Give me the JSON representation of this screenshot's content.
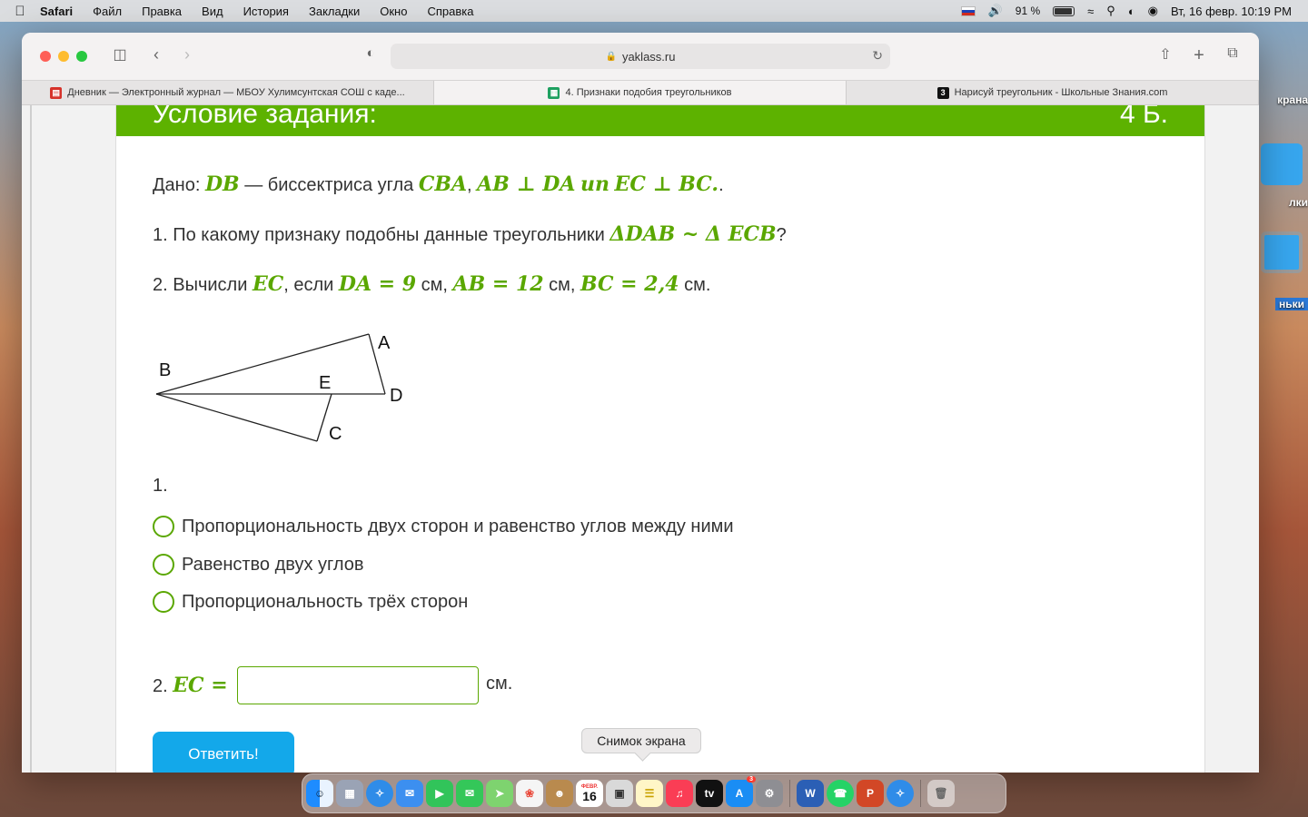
{
  "menubar": {
    "app": "Safari",
    "items": [
      "Файл",
      "Правка",
      "Вид",
      "История",
      "Закладки",
      "Окно",
      "Справка"
    ],
    "battery": "91 %",
    "datetime": "Вт, 16 февр.  10:19 PM"
  },
  "desktop": {
    "labels": [
      "крана",
      "лки",
      "ньки"
    ]
  },
  "browser": {
    "url": "yaklass.ru",
    "tabs": [
      {
        "title": "Дневник — Электронный журнал — МБОУ Хулимсунтская СОШ с каде...",
        "favicon_color": "#d6322a",
        "active": false
      },
      {
        "title": "4. Признаки подобия треугольников",
        "favicon_color": "#1ea060",
        "active": true
      },
      {
        "title": "Нарисуй треугольник - Школьные Знания.com",
        "favicon_color": "#111111",
        "favicon_text": "3",
        "active": false
      }
    ]
  },
  "task": {
    "header_title": "Условие задания:",
    "header_points": "4 Б.",
    "given_prefix": "Дано:",
    "given_db": "DB",
    "given_mid": "— биссектриса угла",
    "given_cba": "CBA",
    "given_comma": ",",
    "given_ab_da": "AB ⊥ DA",
    "given_and": "un",
    "given_ec_bc": "EC ⊥ BC.",
    "given_end": ".",
    "q1_prefix": "1. По какому признаку подобны данные треугольники",
    "q1_math": "ΔDAB ~ Δ ECB",
    "q1_end": "?",
    "q2_prefix": "2. Вычисли",
    "q2_ec": "EC",
    "q2_if": ", если",
    "q2_da": "DA = 9",
    "q2_cm1": " см,",
    "q2_ab": "AB = 12",
    "q2_cm2": " см,",
    "q2_bc": "BC = 2,4",
    "q2_cm3": " см.",
    "figure_labels": {
      "A": "A",
      "B": "B",
      "C": "C",
      "D": "D",
      "E": "E"
    },
    "part1_label": "1.",
    "options": [
      "Пропорциональность двух сторон и равенство углов между ними",
      "Равенство двух углов",
      "Пропорциональность трёх сторон"
    ],
    "part2_label": "2.",
    "part2_math": "EC =",
    "unit": "см.",
    "submit_label": "Ответить!"
  },
  "tooltip": "Снимок экрана",
  "dock": {
    "calendar_month": "ФЕВР.",
    "calendar_day": "16",
    "appstore_badge": "3"
  },
  "colors": {
    "accent_green": "#5db200",
    "button_blue": "#13a8ea"
  }
}
